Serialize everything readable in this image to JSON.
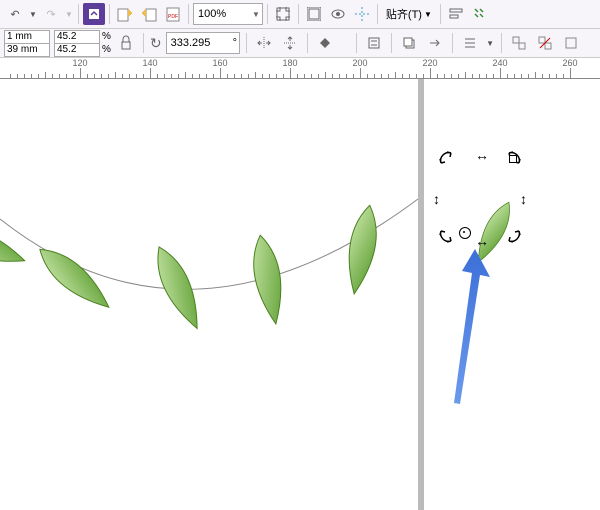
{
  "toolbar1": {
    "zoom_value": "100%",
    "snap_label": "贴齐(T)"
  },
  "toolbar2": {
    "size_x_value": "1 mm",
    "size_y_value": "39 mm",
    "scale_x": "45.2",
    "scale_y": "45.2",
    "percent": "%",
    "lock": "🔒",
    "rotation": "333.295",
    "degree": "°"
  },
  "ruler": {
    "labels": [
      "120",
      "140",
      "160",
      "180",
      "200",
      "220",
      "240",
      "260"
    ]
  },
  "icons": {
    "undo": "↶",
    "redo": "↷",
    "drop": "▼",
    "publish": "⬆",
    "export1": "📄",
    "export2": "📄",
    "pdf": "PDF",
    "screen": "⊞",
    "frame": "▣",
    "eye": "👁",
    "guide": "┊",
    "window": "⊡",
    "options": "☰",
    "rotate": "↻",
    "align1": "⊟",
    "align2": "⊟",
    "order": "☰",
    "front": "⬜",
    "arrow_r": "→",
    "group1": "⊞",
    "group2": "⊡",
    "box": "◫"
  },
  "colors": {
    "leaf_light": "#b8dc8a",
    "leaf_dark": "#5a9c2e",
    "arrow": "#3c6fd8",
    "page_bg": "#ffffff"
  }
}
